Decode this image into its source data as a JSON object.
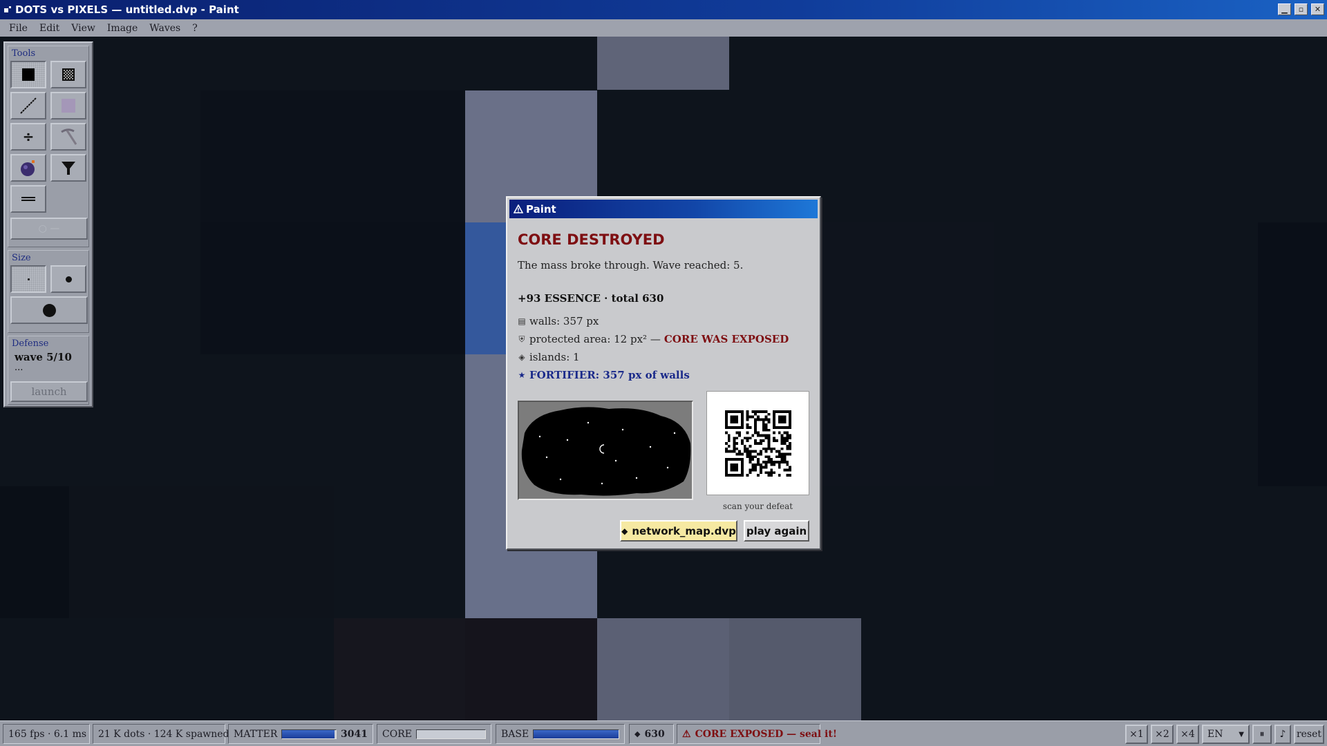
{
  "window": {
    "title": "DOTS vs PIXELS — untitled.dvp - Paint",
    "min_icon": "minimize-icon",
    "max_icon": "maximize-icon",
    "close_icon": "close-icon"
  },
  "menu": [
    "File",
    "Edit",
    "View",
    "Image",
    "Waves",
    "?"
  ],
  "tools": {
    "title": "Tools",
    "items": [
      "solid-wall-tool",
      "dither-wall-tool",
      "line-tool",
      "soft-rect-tool",
      "divider-tool",
      "pickaxe-tool",
      "bomb-tool",
      "funnel-tool",
      "double-line-tool"
    ],
    "size_title": "Size",
    "sizes": [
      "small",
      "medium",
      "large"
    ],
    "defense_title": "Defense",
    "wave": "wave 5/10",
    "wave_extra": "...",
    "launch": "launch"
  },
  "dialog": {
    "title": "Paint",
    "heading": "CORE DESTROYED",
    "message": "The mass broke through. Wave reached: 5.",
    "essence": "+93 ESSENCE · total 630",
    "walls": "walls: 357 px",
    "protected": "protected area: 12 px² —",
    "exposed": "CORE WAS EXPOSED",
    "islands": "islands: 1",
    "fortifier": "FORTIFIER: 357 px of walls",
    "qr_caption": "scan your defeat",
    "file_button": "network_map.dvp",
    "play_again": "play again"
  },
  "statusbar": {
    "fps": "165 fps · 6.1 ms",
    "dots": "21 K dots · 124 K spawned",
    "matter_label": "MATTER",
    "matter_value": "3041",
    "matter_fill": 0.98,
    "core_label": "CORE",
    "core_fill": 0.0,
    "base_label": "BASE",
    "base_fill": 1.0,
    "essence": "630",
    "alert": "CORE EXPOSED — seal it!",
    "speeds": [
      "×1",
      "×2",
      "×4"
    ],
    "language": "EN",
    "pause": "⏸",
    "music": "♪",
    "reset": "reset"
  },
  "colors": {
    "accent": "#1246a8",
    "alert": "#7e0f12",
    "fortifier": "#1a2a8a"
  }
}
